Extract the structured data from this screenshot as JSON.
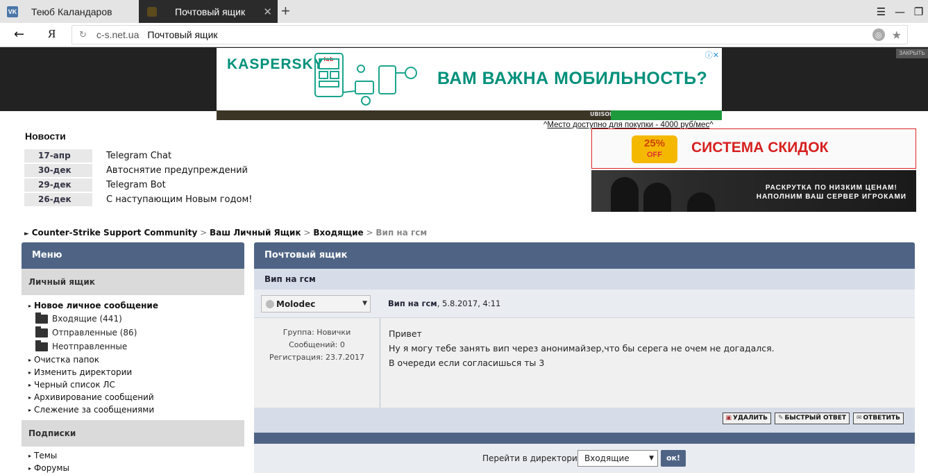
{
  "browser": {
    "tabs": [
      {
        "title": "Теюб Каландаров",
        "icon": "vk-icon",
        "favicon_text": "VK"
      },
      {
        "title": "Почтовый ящик",
        "icon": "site-favicon",
        "active": true
      }
    ],
    "new_tab": "+",
    "window_buttons": [
      "☰",
      "—",
      "❐"
    ],
    "address": {
      "domain": "c-s.net.ua",
      "page_title": "Почтовый ящик"
    },
    "back": "←",
    "yandex": "Я",
    "reload": "↻",
    "star": "★",
    "ext_close": "ЗАКРЫТЬ"
  },
  "ads": {
    "kaspersky_logo": "KASPERSKY",
    "kaspersky_lab": "lab",
    "kaspersky_text": "ВАМ ВАЖНА МОБИЛЬНОСТЬ?",
    "ad_info": "ⓘ✕",
    "strip_brand": "UBISOFT",
    "note_prefix": "^",
    "note_link": "Место доступно для покупки - 4000 руб/мес",
    "note_suffix": "^",
    "discount_badge_top": "25%",
    "discount_badge_bottom": "OFF",
    "discount_text": "СИСТЕМА СКИДОК",
    "server_line1": "РАСКРУТКА ПО НИЗКИМ ЦЕНАМ!",
    "server_line2": "НАПОЛНИМ ВАШ СЕРВЕР ИГРОКАМИ"
  },
  "news": {
    "header": "Новости",
    "items": [
      {
        "date": "17-апр",
        "title": "Telegram Chat"
      },
      {
        "date": "30-дек",
        "title": "Автоснятие предупреждений"
      },
      {
        "date": "29-дек",
        "title": "Telegram Bot"
      },
      {
        "date": "26-дек",
        "title": "С наступающим Новым годом!"
      }
    ]
  },
  "breadcrumb": {
    "arrow": "►",
    "items": [
      "Counter-Strike Support Community",
      "Ваш Личный Ящик",
      "Входящие"
    ],
    "current": "Вип на гсм",
    "sep": ">"
  },
  "menu": {
    "title": "Меню",
    "section1": "Личный ящик",
    "new_message": "Новое личное сообщение",
    "folders": [
      "Входящие (441)",
      "Отправленные (86)",
      "Неотправленные"
    ],
    "items": [
      "Очистка папок",
      "Изменить директории",
      "Черный список ЛС",
      "Архивирование сообщений",
      "Слежение за сообщениями"
    ],
    "section2": "Подписки",
    "subs": [
      "Темы",
      "Форумы"
    ]
  },
  "panel": {
    "title": "Почтовый ящик",
    "subject": "Вип на гсм",
    "user": "Molodec",
    "meta_title": "Вип на гсм",
    "meta_date": ", 5.8.2017, 4:11",
    "group": "Группа: Новички",
    "posts": "Сообщений: 0",
    "registered": "Регистрация: 23.7.2017",
    "message": [
      "Привет",
      "Ну я могу тебе занять вип через анонимайзер,что бы серега не очем не догадался.",
      "В очереди если согласишься ты 3"
    ],
    "buttons": [
      "УДАЛИТЬ",
      "БЫСТРЫЙ ОТВЕТ",
      "ОТВЕТИТЬ"
    ],
    "goto_label": "Перейти в директорию:",
    "goto_value": "Входящие",
    "ok": "ок!"
  }
}
